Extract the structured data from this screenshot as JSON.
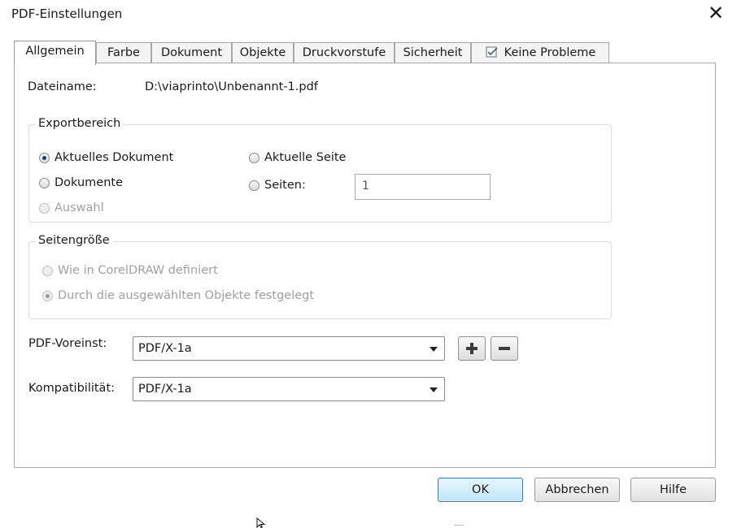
{
  "dialog": {
    "title": "PDF-Einstellungen"
  },
  "tabs": [
    {
      "label": "Allgemein"
    },
    {
      "label": "Farbe"
    },
    {
      "label": "Dokument"
    },
    {
      "label": "Objekte"
    },
    {
      "label": "Druckvorstufe"
    },
    {
      "label": "Sicherheit"
    },
    {
      "label": "Keine Probleme",
      "icon": "checklist-icon"
    }
  ],
  "file": {
    "label": "Dateiname:",
    "value": "D:\\viaprinto\\Unbenannt-1.pdf"
  },
  "export_range": {
    "legend": "Exportbereich",
    "options": {
      "current_document": {
        "label": "Aktuelles Dokument",
        "checked": true
      },
      "documents": {
        "label": "Dokumente",
        "checked": false
      },
      "selection": {
        "label": "Auswahl",
        "checked": false,
        "disabled": true
      },
      "current_page": {
        "label": "Aktuelle Seite",
        "checked": false
      },
      "pages": {
        "label": "Seiten:",
        "checked": false
      }
    },
    "pages_value": "1"
  },
  "page_size": {
    "legend": "Seitengröße",
    "options": {
      "as_defined": {
        "label": "Wie in CorelDRAW definiert",
        "checked": false,
        "disabled": true
      },
      "by_objects": {
        "label": "Durch die ausgewählten Objekte festgelegt",
        "checked": true,
        "disabled": true
      }
    }
  },
  "preset": {
    "label": "PDF-Voreinst:",
    "value": "PDF/X-1a"
  },
  "compatibility": {
    "label": "Kompatibilität:",
    "value": "PDF/X-1a"
  },
  "buttons": {
    "ok": "OK",
    "cancel": "Abbrechen",
    "help": "Hilfe"
  },
  "colors": {
    "ok_border": "#3c7fb1",
    "ok_fill": "#bee6fd",
    "radio_dot": "#1f3f66"
  }
}
